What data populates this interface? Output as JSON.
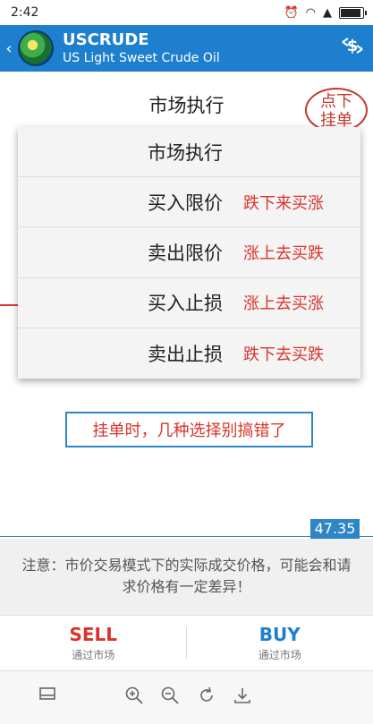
{
  "status": {
    "time": "2:42"
  },
  "app": {
    "title": "USCRUDE",
    "subtitle": "US Light Sweet Crude Oil",
    "back": "‹",
    "trade_icon": "$"
  },
  "order": {
    "selected": "市场执行",
    "hint": [
      "点下",
      "挂单"
    ],
    "options": [
      {
        "label": "市场执行",
        "note": ""
      },
      {
        "label": "买入限价",
        "note": "跌下来买涨"
      },
      {
        "label": "卖出限价",
        "note": "涨上去买跌"
      },
      {
        "label": "买入止损",
        "note": "涨上去买涨"
      },
      {
        "label": "卖出止损",
        "note": "跌下去买跌"
      }
    ]
  },
  "callout": "挂单时，几种选择别搞错了",
  "price": "47.35",
  "notice": "注意：市价交易模式下的实际成交价格，可能会和请求价格有一定差异！",
  "trade": {
    "sell": {
      "label": "SELL",
      "sub": "通过市场"
    },
    "buy": {
      "label": "BUY",
      "sub": "通过市场"
    }
  },
  "toolbar_icons": [
    "layout-icon",
    "zoom-in-icon",
    "zoom-out-icon",
    "refresh-icon",
    "download-icon"
  ],
  "colors": {
    "accent": "#1e7fcf",
    "sell": "#d9342b",
    "buy": "#1e7fcf",
    "annotation": "#d9342b"
  },
  "battery_level": 0.85
}
